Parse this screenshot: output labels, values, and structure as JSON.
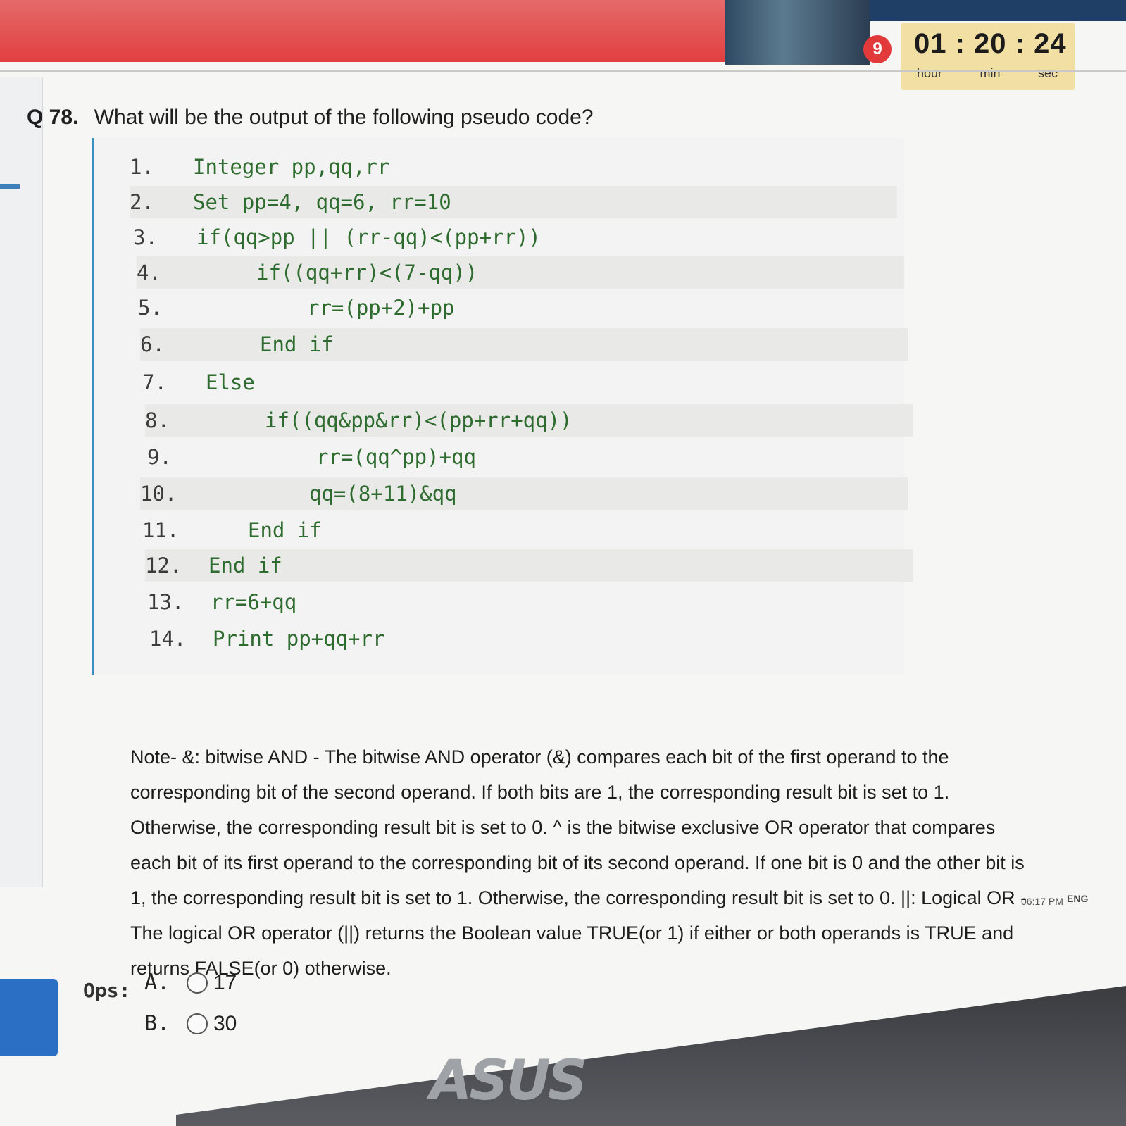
{
  "header": {
    "question_badge": "9",
    "timer": {
      "value": "01 : 20 : 24",
      "hour_label": "hour",
      "min_label": "min",
      "sec_label": "sec"
    }
  },
  "question": {
    "number": "Q 78.",
    "text": "What will be the output of the following pseudo code?"
  },
  "code": [
    {
      "n": "1.",
      "text": "Integer pp,qq,rr"
    },
    {
      "n": "2.",
      "text": "Set pp=4, qq=6, rr=10"
    },
    {
      "n": "3.",
      "text": "if(qq>pp || (rr-qq)<(pp+rr))"
    },
    {
      "n": "4.",
      "text": "if((qq+rr)<(7-qq))"
    },
    {
      "n": "5.",
      "text": "rr=(pp+2)+pp"
    },
    {
      "n": "6.",
      "text": "End if"
    },
    {
      "n": "7.",
      "text": "Else"
    },
    {
      "n": "8.",
      "text": "if((qq&pp&rr)<(pp+rr+qq))"
    },
    {
      "n": "9.",
      "text": "rr=(qq^pp)+qq"
    },
    {
      "n": "10.",
      "text": "qq=(8+11)&qq"
    },
    {
      "n": "11.",
      "text": "End if"
    },
    {
      "n": "12.",
      "text": "End if"
    },
    {
      "n": "13.",
      "text": "rr=6+qq"
    },
    {
      "n": "14.",
      "text": "Print pp+qq+rr"
    }
  ],
  "note": "Note- &: bitwise AND - The bitwise AND operator (&) compares each bit of the first operand to the corresponding bit of the second operand. If both bits are 1, the corresponding result bit is set to 1. Otherwise, the corresponding result bit is set to 0. ^ is the bitwise exclusive OR operator that compares each bit of its first operand to the corresponding bit of its second operand. If one bit is 0 and the other bit is 1, the corresponding result bit is set to 1. Otherwise, the corresponding result bit is set to 0. ||: Logical OR - The logical OR operator (||) returns the Boolean value TRUE(or 1) if either or both operands is TRUE and returns FALSE(or 0) otherwise.",
  "options": {
    "label": "Ops:",
    "items": [
      {
        "letter": "A.",
        "value": "17"
      },
      {
        "letter": "B.",
        "value": "30"
      }
    ]
  },
  "taskbar": {
    "time": "06:17 PM",
    "lang": "ENG"
  },
  "brand": "ASUS",
  "colors": {
    "header_red": "#e23f3f",
    "timer_bg": "#f1dfa4",
    "code_border": "#3a8fc2",
    "code_text": "#2e6b2e"
  }
}
